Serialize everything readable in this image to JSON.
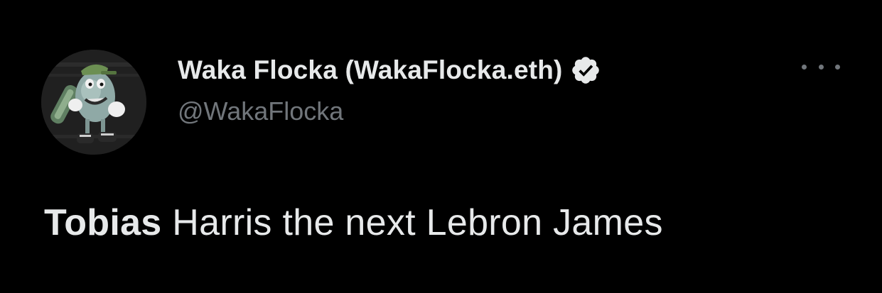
{
  "author": {
    "display_name": "Waka Flocka (WakaFlocka.eth)",
    "handle": "@WakaFlocka",
    "verified": true,
    "avatar_icon": "cartoon-character-avatar"
  },
  "tweet": {
    "text_bold": "Tobias",
    "text_rest": " Harris the next Lebron James"
  },
  "actions": {
    "more_icon": "more-options-icon"
  },
  "colors": {
    "background": "#000000",
    "primary_text": "#e7e9ea",
    "secondary_text": "#71767b"
  }
}
